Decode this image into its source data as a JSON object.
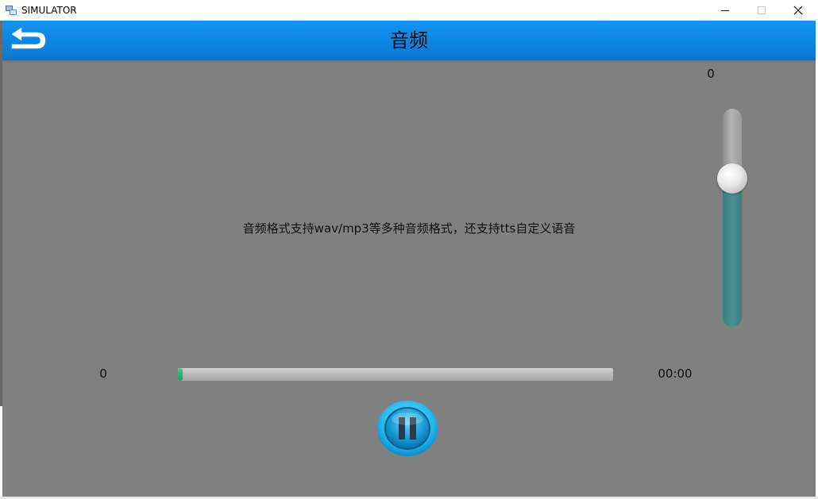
{
  "window": {
    "title": "SIMULATOR",
    "icon": "simulator-app-icon",
    "controls": [
      "minimize-icon",
      "maximize-icon",
      "close-icon"
    ]
  },
  "header": {
    "title": "音频",
    "back_icon": "back-arrow-icon",
    "color": "#0a84e0"
  },
  "main": {
    "description": "音频格式支持wav/mp3等多种音频格式，还支持tts自定义语音",
    "background": "#808080"
  },
  "volume": {
    "value_label": "0",
    "level_fraction": 0.68,
    "fill_color": "#4a8a8c"
  },
  "player": {
    "current_time": "0",
    "total_time": "00:00",
    "progress_fraction": 0.0,
    "progress_color": "#20c080",
    "pause_icon": "pause-icon"
  }
}
